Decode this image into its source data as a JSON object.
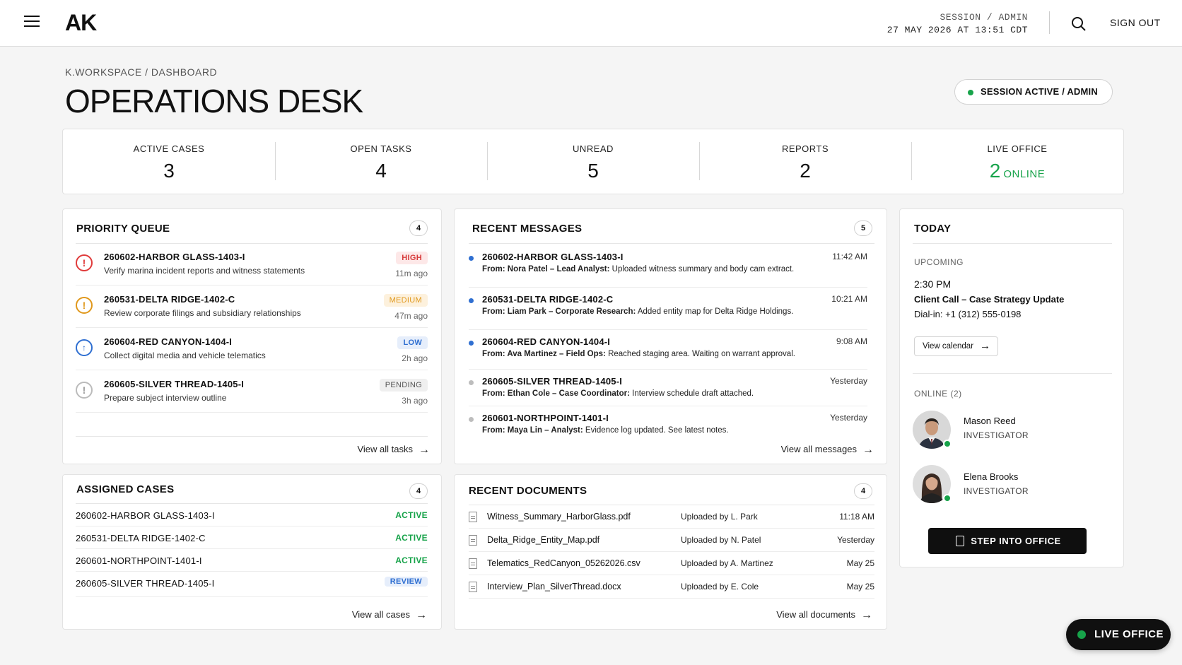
{
  "topbar": {
    "logo": "AK",
    "session_label": "SESSION / ADMIN",
    "session_datetime": "27 MAY 2026 AT 13:51 CDT",
    "sign_out": "SIGN OUT"
  },
  "header": {
    "breadcrumb_root": "K.WORKSPACE",
    "breadcrumb_sep": "/",
    "breadcrumb_current": "DASHBOARD",
    "title": "OPERATIONS DESK",
    "session_status": "SESSION ACTIVE / ADMIN",
    "status_color": "#17a34a"
  },
  "stats": [
    {
      "label": "ACTIVE CASES",
      "value": "3"
    },
    {
      "label": "OPEN TASKS",
      "value": "4"
    },
    {
      "label": "UNREAD",
      "value": "5"
    },
    {
      "label": "REPORTS",
      "value": "2"
    },
    {
      "label": "LIVE OFFICE",
      "value": "2",
      "sub": "ONLINE"
    }
  ],
  "priority_queue": {
    "title": "PRIORITY QUEUE",
    "count": "4",
    "items": [
      {
        "id": "260602-HARBOR GLASS-1403-I",
        "desc": "Verify marina incident reports and witness statements",
        "priority": "HIGH",
        "age": "11m ago",
        "icon": "alert-circle-icon"
      },
      {
        "id": "260531-DELTA RIDGE-1402-C",
        "desc": "Review corporate filings and subsidiary relationships",
        "priority": "MEDIUM",
        "age": "47m ago",
        "icon": "alert-circle-icon"
      },
      {
        "id": "260604-RED CANYON-1404-I",
        "desc": "Collect digital media and vehicle telematics",
        "priority": "LOW",
        "age": "2h ago",
        "icon": "info-circle-icon"
      },
      {
        "id": "260605-SILVER THREAD-1405-I",
        "desc": "Prepare subject interview outline",
        "priority": "PENDING",
        "age": "3h ago",
        "icon": "alert-circle-icon"
      }
    ],
    "footer_link": "View all tasks"
  },
  "recent_messages": {
    "title": "RECENT MESSAGES",
    "count": "5",
    "items": [
      {
        "id": "260602-HARBOR GLASS-1403-I",
        "from": "From: Nora Patel – Lead Analyst:",
        "text": "Uploaded witness summary and body cam extract.",
        "time": "11:42 AM",
        "unread": true
      },
      {
        "id": "260531-DELTA RIDGE-1402-C",
        "from": "From: Liam Park – Corporate Research:",
        "text": "Added entity map for Delta Ridge Holdings.",
        "time": "10:21 AM",
        "unread": true
      },
      {
        "id": "260604-RED CANYON-1404-I",
        "from": "From: Ava Martinez – Field Ops:",
        "text": "Reached staging area. Waiting on warrant approval.",
        "time": "9:08 AM",
        "unread": true
      },
      {
        "id": "260605-SILVER THREAD-1405-I",
        "from": "From: Ethan Cole – Case Coordinator:",
        "text": "Interview schedule draft attached.",
        "time": "Yesterday",
        "unread": false
      },
      {
        "id": "260601-NORTHPOINT-1401-I",
        "from": "From: Maya Lin – Analyst:",
        "text": "Evidence log updated. See latest notes.",
        "time": "Yesterday",
        "unread": false
      }
    ],
    "footer_link": "View all messages"
  },
  "today": {
    "title": "TODAY",
    "upcoming_label": "UPCOMING",
    "time": "2:30 PM",
    "event": "Client Call – Case Strategy Update",
    "dial_in": "Dial-in: +1 (312) 555-0198",
    "calendar_button": "View calendar",
    "online_label": "ONLINE (2)",
    "people": [
      {
        "name": "Mason Reed",
        "role": "INVESTIGATOR"
      },
      {
        "name": "Elena Brooks",
        "role": "INVESTIGATOR"
      }
    ],
    "step_button": "STEP INTO OFFICE"
  },
  "assigned_cases": {
    "title": "ASSIGNED CASES",
    "count": "4",
    "items": [
      {
        "name": "260602-HARBOR GLASS-1403-I",
        "status": "ACTIVE"
      },
      {
        "name": "260531-DELTA RIDGE-1402-C",
        "status": "ACTIVE"
      },
      {
        "name": "260601-NORTHPOINT-1401-I",
        "status": "ACTIVE"
      },
      {
        "name": "260605-SILVER THREAD-1405-I",
        "status": "REVIEW"
      }
    ],
    "footer_link": "View all cases"
  },
  "recent_documents": {
    "title": "RECENT DOCUMENTS",
    "count": "4",
    "items": [
      {
        "file": "Witness_Summary_HarborGlass.pdf",
        "uploader": "Uploaded by L. Park",
        "date": "11:18 AM"
      },
      {
        "file": "Delta_Ridge_Entity_Map.pdf",
        "uploader": "Uploaded by N. Patel",
        "date": "Yesterday"
      },
      {
        "file": "Telematics_RedCanyon_05262026.csv",
        "uploader": "Uploaded by A. Martinez",
        "date": "May 25"
      },
      {
        "file": "Interview_Plan_SilverThread.docx",
        "uploader": "Uploaded by E. Cole",
        "date": "May 25"
      }
    ],
    "footer_link": "View all documents"
  },
  "live_office_button": "LIVE OFFICE",
  "colors": {
    "green": "#17a34a",
    "high": "#d63a3a",
    "medium": "#e0981c",
    "low": "#2f6fd1",
    "dark": "#0f0f0f"
  }
}
